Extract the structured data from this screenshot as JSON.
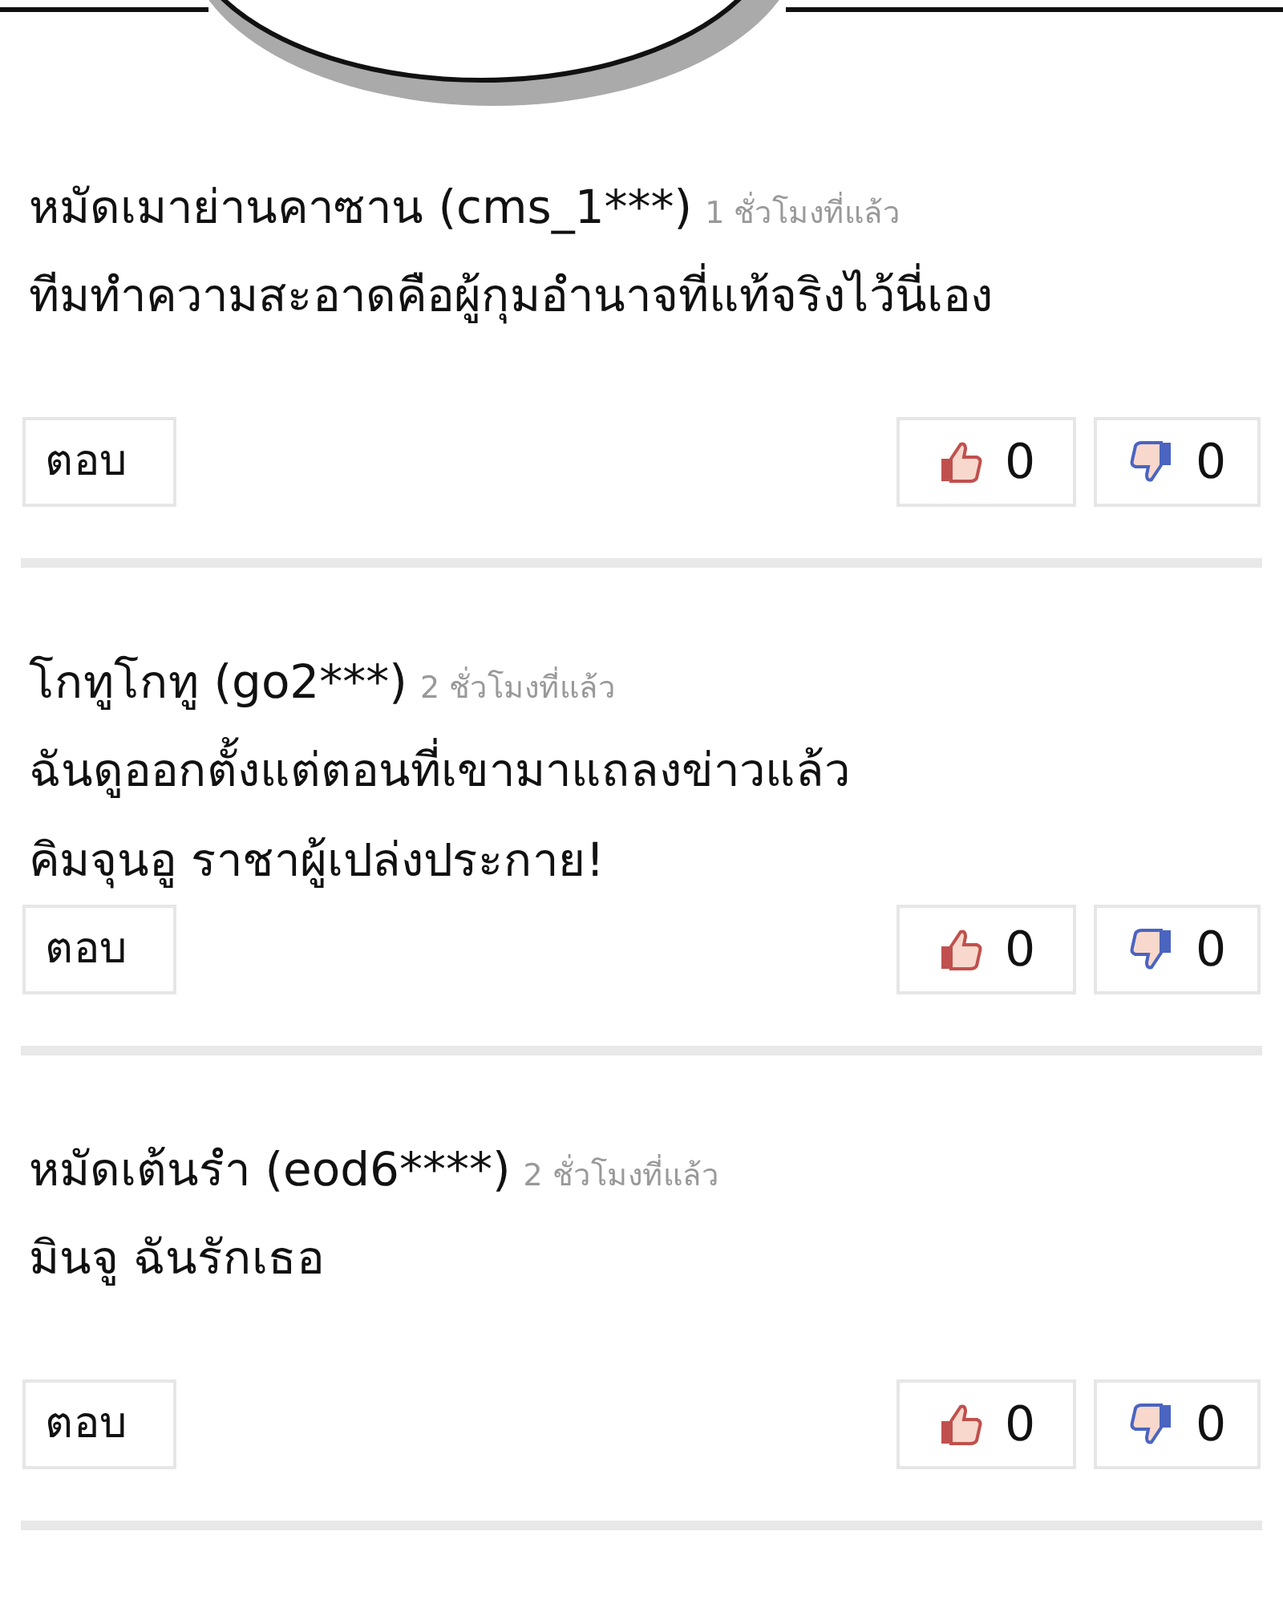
{
  "comments": [
    {
      "author": "หมัดเมาย่านคาซาน (cms_1***)",
      "time": "1 ชั่วโมงที่แล้ว",
      "lines": [
        "ทีมทำความสะอาดคือผู้กุมอำนาจที่แท้จริงไว้นี่เอง"
      ],
      "reply": "ตอบ",
      "likes": "0",
      "dislikes": "0"
    },
    {
      "author": "โกทูโกทู (go2***)",
      "time": "2 ชั่วโมงที่แล้ว",
      "lines": [
        "ฉันดูออกตั้งแต่ตอนที่เขามาแถลงข่าวแล้ว",
        "คิมจุนอู ราชาผู้เปล่งประกาย!"
      ],
      "reply": "ตอบ",
      "likes": "0",
      "dislikes": "0"
    },
    {
      "author": "หมัดเต้นรำ (eod6****)",
      "time": "2 ชั่วโมงที่แล้ว",
      "lines": [
        "มินจู ฉันรักเธอ"
      ],
      "reply": "ตอบ",
      "likes": "0",
      "dislikes": "0"
    }
  ]
}
